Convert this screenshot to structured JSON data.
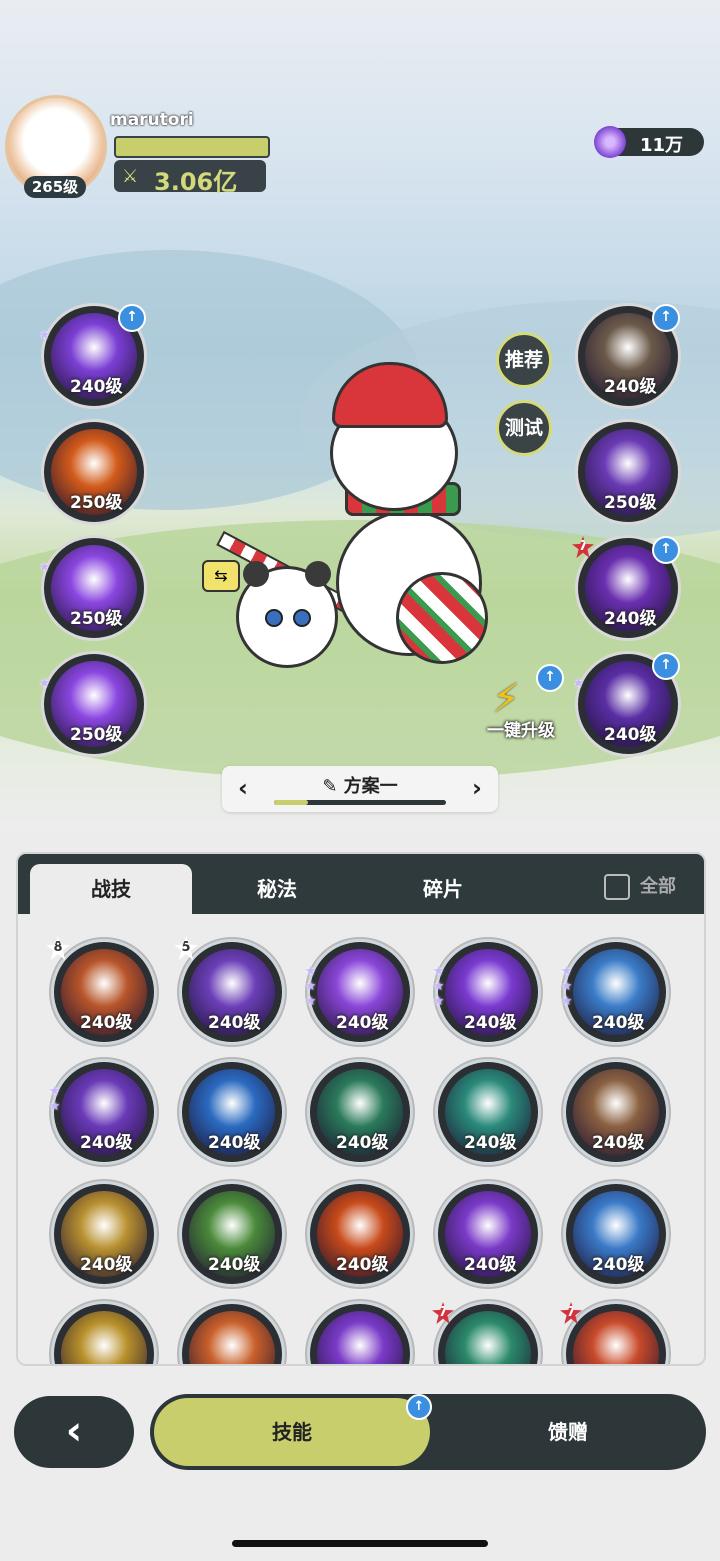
{
  "profile": {
    "username": "marutori",
    "level": "265级",
    "power": "3.06亿",
    "xp_fraction": 1.0
  },
  "currency": {
    "amount": "11万",
    "icon": "purple-orb-icon"
  },
  "side_buttons": {
    "recommend": "推荐",
    "test": "测试"
  },
  "upgrade_all": "一键升级",
  "equipped_skills": {
    "left": [
      {
        "level": "240级",
        "color": "#7b3fd4",
        "icon": "crown-sigil-icon",
        "upgrade": true,
        "star": true
      },
      {
        "level": "250级",
        "color": "#d25a1a",
        "icon": "fire-wolf-icon",
        "upgrade": false,
        "star": false
      },
      {
        "level": "250级",
        "color": "#8a46e0",
        "icon": "arrow-slash-icon",
        "upgrade": false,
        "star": true
      },
      {
        "level": "250级",
        "color": "#8a46e0",
        "icon": "wings-icon",
        "upgrade": false,
        "star": true
      }
    ],
    "right": [
      {
        "level": "240级",
        "color": "#6b5a4a",
        "icon": "shadow-figure-icon",
        "upgrade": true,
        "star": false,
        "badge": ""
      },
      {
        "level": "250级",
        "color": "#6a3ab4",
        "icon": "eye-icon",
        "upgrade": false,
        "star": false,
        "badge": ""
      },
      {
        "level": "240级",
        "color": "#6a2fb0",
        "icon": "crossed-swords-icon",
        "upgrade": true,
        "star": false,
        "badge": "7"
      },
      {
        "level": "240级",
        "color": "#5a2ea4",
        "icon": "heart-figure-icon",
        "upgrade": true,
        "star": true,
        "badge": ""
      }
    ]
  },
  "preset": {
    "prev": "‹",
    "name": "方案一",
    "next": "›",
    "progress": 0.2
  },
  "panel": {
    "tabs": [
      "战技",
      "秘法",
      "碎片"
    ],
    "filter_label": "全部"
  },
  "skills": [
    {
      "level": "240级",
      "color": "#b8552a",
      "icon": "shield-blast-icon",
      "badge": "8",
      "stars": 0
    },
    {
      "level": "240级",
      "color": "#6b3fb8",
      "icon": "robot-figure-icon",
      "badge": "5",
      "stars": 0
    },
    {
      "level": "240级",
      "color": "#8a46d8",
      "icon": "star-burst-icon",
      "badge": "",
      "stars": 3
    },
    {
      "level": "240级",
      "color": "#7a3ad0",
      "icon": "raised-hand-icon",
      "badge": "",
      "stars": 3
    },
    {
      "level": "240级",
      "color": "#3a7cc8",
      "icon": "ice-block-icon",
      "badge": "",
      "stars": 3
    },
    {
      "level": "240级",
      "color": "#6a3ab8",
      "icon": "four-point-star-icon",
      "badge": "",
      "stars": 2
    },
    {
      "level": "240级",
      "color": "#2a6ac0",
      "icon": "water-wave-icon",
      "badge": "",
      "stars": 0
    },
    {
      "level": "240级",
      "color": "#2a7a5a",
      "icon": "thorn-vine-icon",
      "badge": "",
      "stars": 0
    },
    {
      "level": "240级",
      "color": "#2a8a7a",
      "icon": "whirlpool-icon",
      "badge": "",
      "stars": 0
    },
    {
      "level": "240级",
      "color": "#8a6040",
      "icon": "stone-tablet-icon",
      "badge": "",
      "stars": 0
    },
    {
      "level": "240级",
      "color": "#b89030",
      "icon": "sparkle-plus-icon",
      "badge": "",
      "stars": 0
    },
    {
      "level": "240级",
      "color": "#4a8a3a",
      "icon": "leaf-scroll-icon",
      "badge": "",
      "stars": 0
    },
    {
      "level": "240级",
      "color": "#c84a1a",
      "icon": "flame-icon",
      "badge": "",
      "stars": 0
    },
    {
      "level": "240级",
      "color": "#7a3ac8",
      "icon": "purple-eye-icon",
      "badge": "",
      "stars": 0
    },
    {
      "level": "240级",
      "color": "#3a7ac8",
      "icon": "ice-shard-icon",
      "badge": "",
      "stars": 0
    },
    {
      "level": "",
      "color": "#b8902a",
      "icon": "gold-triangle-icon",
      "badge": "",
      "stars": 0
    },
    {
      "level": "",
      "color": "#c8602a",
      "icon": "spiky-beast-icon",
      "badge": "",
      "stars": 0
    },
    {
      "level": "",
      "color": "#7a3ac8",
      "icon": "purple-swirl-icon",
      "badge": "",
      "stars": 0
    },
    {
      "level": "",
      "color": "#2a8a6a",
      "icon": "green-slash-icon",
      "badge": "7",
      "stars": 0
    },
    {
      "level": "",
      "color": "#c84a2a",
      "icon": "fire-orb-icon",
      "badge": "7",
      "stars": 0
    }
  ],
  "bottom_nav": {
    "back": "‹",
    "skills_label": "技能",
    "gifts_label": "馈赠"
  }
}
